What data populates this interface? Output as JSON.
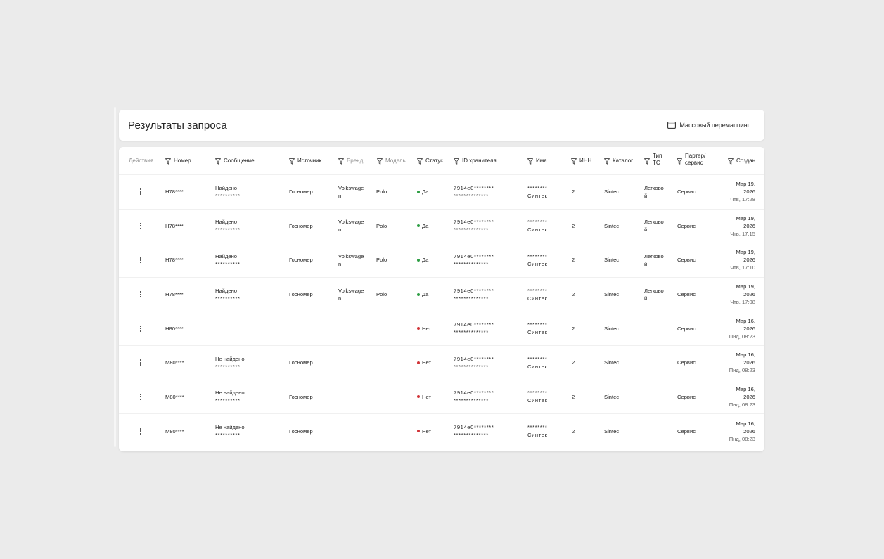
{
  "header": {
    "title": "Результаты запроса",
    "bulk_button_label": "Массовый перемаппинг",
    "bulk_button_icon": "window-icon"
  },
  "colors": {
    "yes": "#2e9e44",
    "no": "#d13438"
  },
  "columns": [
    {
      "key": "actions",
      "label": "Действия",
      "filter": false,
      "muted": true
    },
    {
      "key": "number",
      "label": "Номер",
      "filter": true,
      "muted": false
    },
    {
      "key": "message",
      "label": "Сообщение",
      "filter": true,
      "muted": false
    },
    {
      "key": "source",
      "label": "Источник",
      "filter": true,
      "muted": false
    },
    {
      "key": "brand",
      "label": "Бренд",
      "filter": true,
      "muted": true
    },
    {
      "key": "model",
      "label": "Модель",
      "filter": true,
      "muted": true
    },
    {
      "key": "status",
      "label": "Статус",
      "filter": true,
      "muted": false
    },
    {
      "key": "holder_id",
      "label": "ID хранителя",
      "filter": true,
      "muted": false
    },
    {
      "key": "name",
      "label": "Имя",
      "filter": true,
      "muted": false
    },
    {
      "key": "inn",
      "label": "ИНН",
      "filter": true,
      "muted": false
    },
    {
      "key": "catalog",
      "label": "Каталог",
      "filter": true,
      "muted": false
    },
    {
      "key": "vehicle_type",
      "label": "Тип ТС",
      "filter": true,
      "muted": false
    },
    {
      "key": "partner",
      "label": "Партер/ сервис",
      "filter": true,
      "muted": false
    },
    {
      "key": "created",
      "label": "Создан",
      "filter": true,
      "muted": false
    }
  ],
  "rows": [
    {
      "number": "H78****",
      "message": "Найдено",
      "message_sub": "**********",
      "source": "Госномер",
      "brand": "Volkswage n",
      "model": "Polo",
      "status": "Да",
      "status_kind": "yes",
      "holder_id": "7914e0********",
      "holder_id_sub": "**************",
      "name": "********",
      "name_sub": "Синтек",
      "inn": "2",
      "catalog": "Sintec",
      "vehicle_type": "Легково й",
      "partner": "Сервис",
      "created_date": "Мар 19, 2026",
      "created_time": "Чтв, 17:28"
    },
    {
      "number": "H78****",
      "message": "Найдено",
      "message_sub": "**********",
      "source": "Госномер",
      "brand": "Volkswage n",
      "model": "Polo",
      "status": "Да",
      "status_kind": "yes",
      "holder_id": "7914e0********",
      "holder_id_sub": "**************",
      "name": "********",
      "name_sub": "Синтек",
      "inn": "2",
      "catalog": "Sintec",
      "vehicle_type": "Легково й",
      "partner": "Сервис",
      "created_date": "Мар 19, 2026",
      "created_time": "Чтв, 17:15"
    },
    {
      "number": "H78****",
      "message": "Найдено",
      "message_sub": "**********",
      "source": "Госномер",
      "brand": "Volkswage n",
      "model": "Polo",
      "status": "Да",
      "status_kind": "yes",
      "holder_id": "7914e0********",
      "holder_id_sub": "**************",
      "name": "********",
      "name_sub": "Синтек",
      "inn": "2",
      "catalog": "Sintec",
      "vehicle_type": "Легково й",
      "partner": "Сервис",
      "created_date": "Мар 19, 2026",
      "created_time": "Чтв, 17:10"
    },
    {
      "number": "H78****",
      "message": "Найдено",
      "message_sub": "**********",
      "source": "Госномер",
      "brand": "Volkswage n",
      "model": "Polo",
      "status": "Да",
      "status_kind": "yes",
      "holder_id": "7914e0********",
      "holder_id_sub": "**************",
      "name": "********",
      "name_sub": "Синтек",
      "inn": "2",
      "catalog": "Sintec",
      "vehicle_type": "Легково й",
      "partner": "Сервис",
      "created_date": "Мар 19, 2026",
      "created_time": "Чтв, 17:08"
    },
    {
      "number": "H80****",
      "message": "",
      "message_sub": "",
      "source": "",
      "brand": "",
      "model": "",
      "status": "Нет",
      "status_kind": "no",
      "holder_id": "7914e0********",
      "holder_id_sub": "**************",
      "name": "********",
      "name_sub": "Синтек",
      "inn": "2",
      "catalog": "Sintec",
      "vehicle_type": "",
      "partner": "Сервис",
      "created_date": "Мар 16, 2026",
      "created_time": "Пнд, 08:23"
    },
    {
      "number": "M80****",
      "message": "Не найдено",
      "message_sub": "**********",
      "source": "Госномер",
      "brand": "",
      "model": "",
      "status": "Нет",
      "status_kind": "no",
      "holder_id": "7914e0********",
      "holder_id_sub": "**************",
      "name": "********",
      "name_sub": "Синтек",
      "inn": "2",
      "catalog": "Sintec",
      "vehicle_type": "",
      "partner": "Сервис",
      "created_date": "Мар 16, 2026",
      "created_time": "Пнд, 08:23"
    },
    {
      "number": "M80****",
      "message": "Не найдено",
      "message_sub": "**********",
      "source": "Госномер",
      "brand": "",
      "model": "",
      "status": "Нет",
      "status_kind": "no",
      "holder_id": "7914e0********",
      "holder_id_sub": "**************",
      "name": "********",
      "name_sub": "Синтек",
      "inn": "2",
      "catalog": "Sintec",
      "vehicle_type": "",
      "partner": "Сервис",
      "created_date": "Мар 16, 2026",
      "created_time": "Пнд, 08:23"
    },
    {
      "number": "M80****",
      "message": "Не найдено",
      "message_sub": "**********",
      "source": "Госномер",
      "brand": "",
      "model": "",
      "status": "Нет",
      "status_kind": "no",
      "holder_id": "7914e0********",
      "holder_id_sub": "**************",
      "name": "********",
      "name_sub": "Синтек",
      "inn": "2",
      "catalog": "Sintec",
      "vehicle_type": "",
      "partner": "Сервис",
      "created_date": "Мар 16, 2026",
      "created_time": "Пнд, 08:23"
    }
  ]
}
